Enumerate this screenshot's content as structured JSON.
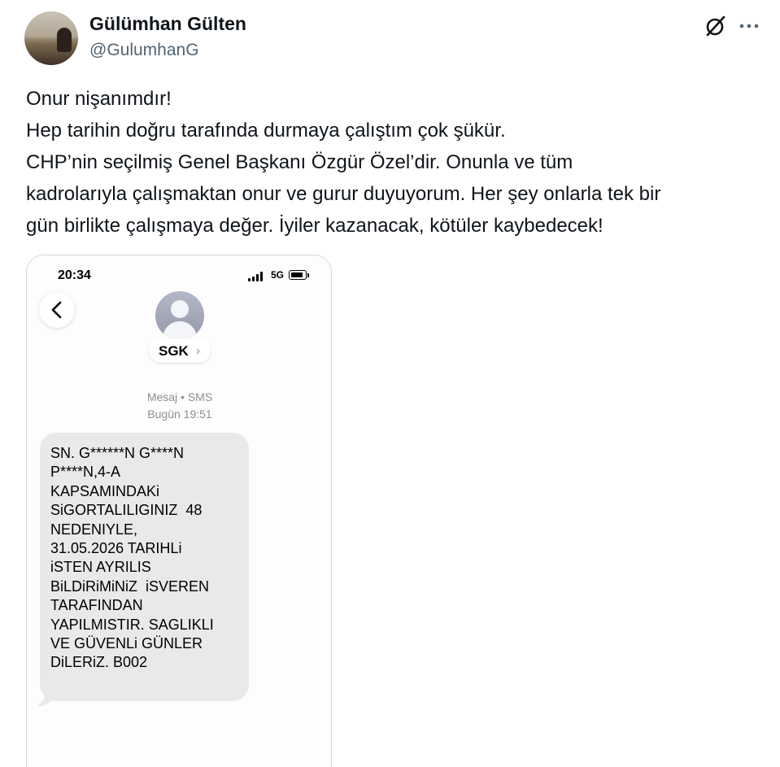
{
  "post": {
    "author": {
      "display_name": "Gülümhan Gülten",
      "handle": "@GulumhanG",
      "avatar_icon": "profile-photo"
    },
    "actions": {
      "grok_icon": "grok-icon",
      "more_icon": "more-icon"
    },
    "text_lines": [
      "Onur nişanımdır!",
      "Hep tarihin doğru tarafında durmaya çalıştım çok şükür.",
      "CHP’nin seçilmiş Genel Başkanı Özgür Özel’dir. Onunla ve tüm",
      "kadrolarıyla çalışmaktan onur ve gurur duyuyorum. Her şey onlarla tek bir",
      "gün birlikte çalışmaya değer. İyiler kazanacak, kötüler kaybedecek!"
    ]
  },
  "screenshot": {
    "status_bar": {
      "time": "20:34",
      "network": "5G"
    },
    "contact": {
      "name": "SGK",
      "chevron": "›"
    },
    "message_meta": {
      "type": "Mesaj • SMS",
      "date": "Bugün 19:51"
    },
    "message_lines": [
      "SN. G******N G****N",
      "P****N,4-A",
      "KAPSAMINDAKi",
      "SiGORTALILIGINIZ  48",
      "NEDENIYLE,",
      "31.05.2026 TARIHLi",
      "iSTEN AYRILIS",
      "BiLDiRiMiNiZ  iSVEREN",
      "TARAFINDAN",
      "YAPILMISTIR. SAGLIKLI",
      "VE GÜVENLi GÜNLER",
      "DiLERiZ. B002"
    ]
  }
}
